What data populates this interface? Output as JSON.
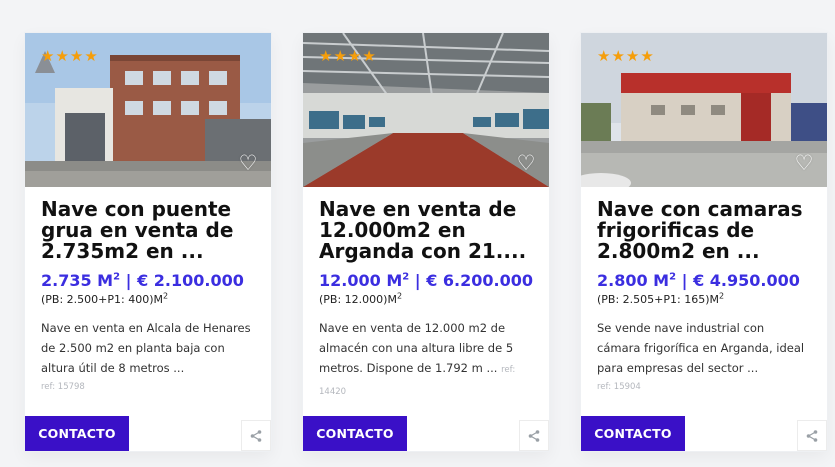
{
  "listings": [
    {
      "rating": 4,
      "title": "Nave con puente grua en venta de 2.735m2 en ...",
      "area": "2.735 M",
      "area_unit_exp": "2",
      "price": " | € 2.100.000",
      "breakdown": "(PB: 2.500+P1: 400)M",
      "breakdown_exp": "2",
      "description": "Nave en venta en Alcala de Henares  de 2.500 m2 en planta baja con altura útil de 8 metros ...",
      "ref": "ref: 15798",
      "contact_label": "CONTACTO",
      "favorite_icon": "heart-outline-icon",
      "share_icon": "share-icon"
    },
    {
      "rating": 4,
      "title": "Nave en venta de 12.000m2 en Arganda con 21....",
      "area": "12.000 M",
      "area_unit_exp": "2",
      "price": " | € 6.200.000",
      "breakdown": "(PB: 12.000)M",
      "breakdown_exp": "2",
      "description": "Nave en venta de 12.000 m2 de almacén con una altura libre de 5 metros. Dispone de 1.792 m ...",
      "ref": "ref: 14420",
      "contact_label": "CONTACTO",
      "favorite_icon": "heart-outline-icon",
      "share_icon": "share-icon"
    },
    {
      "rating": 4,
      "title": "Nave con camaras frigorificas de 2.800m2 en ...",
      "area": "2.800 M",
      "area_unit_exp": "2",
      "price": " | € 4.950.000",
      "breakdown": "(PB: 2.505+P1: 165)M",
      "breakdown_exp": "2",
      "description": "Se vende nave industrial con cámara frigorífica en Arganda, ideal para empresas del sector ...",
      "ref": "ref: 15904",
      "contact_label": "CONTACTO",
      "favorite_icon": "heart-outline-icon",
      "share_icon": "share-icon"
    }
  ],
  "colors": {
    "accent": "#3b2ee0",
    "button": "#3a10c7",
    "star": "#f59e0b"
  }
}
